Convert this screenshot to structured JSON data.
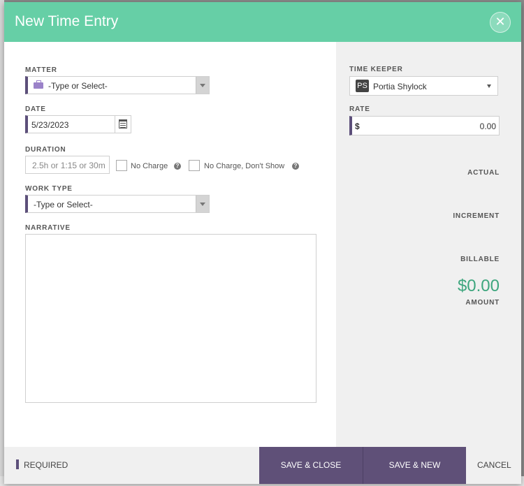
{
  "modal": {
    "title": "New Time Entry",
    "close_icon": "close-icon"
  },
  "matter": {
    "label": "MATTER",
    "placeholder": "-Type or Select-",
    "icon": "briefcase-icon"
  },
  "date": {
    "label": "DATE",
    "value": "5/23/2023",
    "icon": "calendar-icon"
  },
  "duration": {
    "label": "DURATION",
    "placeholder": "2.5h or 1:15 or 30m",
    "no_charge_label": "No Charge",
    "no_charge_dont_show_label": "No Charge, Don't Show"
  },
  "work_type": {
    "label": "WORK TYPE",
    "placeholder": "-Type or Select-"
  },
  "narrative": {
    "label": "NARRATIVE",
    "value": ""
  },
  "time_keeper": {
    "label": "TIME KEEPER",
    "initials": "PS",
    "name": "Portia Shylock"
  },
  "rate": {
    "label": "RATE",
    "currency": "$",
    "value": "0.00"
  },
  "summary": {
    "actual_label": "ACTUAL",
    "increment_label": "INCREMENT",
    "billable_label": "BILLABLE",
    "amount_value": "$0.00",
    "amount_label": "AMOUNT",
    "amount_color": "#3ea67e"
  },
  "footer": {
    "required_label": "REQUIRED",
    "save_close_label": "SAVE & CLOSE",
    "save_new_label": "SAVE & NEW",
    "cancel_label": "CANCEL"
  },
  "colors": {
    "header": "#66cfa6",
    "accent": "#5f5078"
  }
}
